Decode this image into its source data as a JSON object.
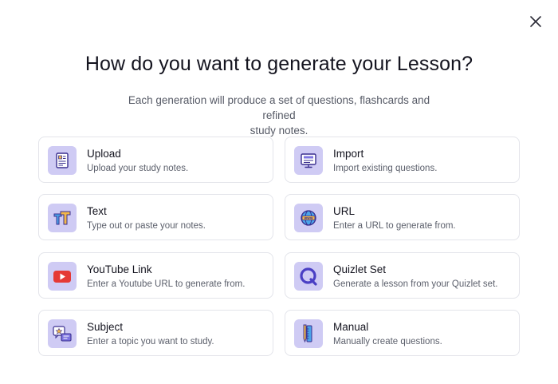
{
  "modal": {
    "title": "How do you want to generate your Lesson?",
    "subtitle_line1": "Each generation will produce a set of questions, flashcards and refined",
    "subtitle_line2": "study notes."
  },
  "options": [
    {
      "title": "Upload",
      "description": "Upload your study notes.",
      "icon": "document-upload-icon"
    },
    {
      "title": "Import",
      "description": "Import existing questions.",
      "icon": "monitor-import-icon"
    },
    {
      "title": "Text",
      "description": "Type out or paste your notes.",
      "icon": "text-tt-icon"
    },
    {
      "title": "URL",
      "description": "Enter a URL to generate from.",
      "icon": "globe-www-icon"
    },
    {
      "title": "YouTube Link",
      "description": "Enter a Youtube URL to generate from.",
      "icon": "youtube-play-icon"
    },
    {
      "title": "Quizlet Set",
      "description": "Generate a lesson from your Quizlet set.",
      "icon": "quizlet-logo-icon"
    },
    {
      "title": "Subject",
      "description": "Enter a topic you want to study.",
      "icon": "subject-chat-icon"
    },
    {
      "title": "Manual",
      "description": "Manually create questions.",
      "icon": "pencil-ruler-icon"
    }
  ],
  "colors": {
    "icon_tile": "#cfcbf4",
    "accent": "#4a3fc4",
    "youtube": "#e53935"
  }
}
